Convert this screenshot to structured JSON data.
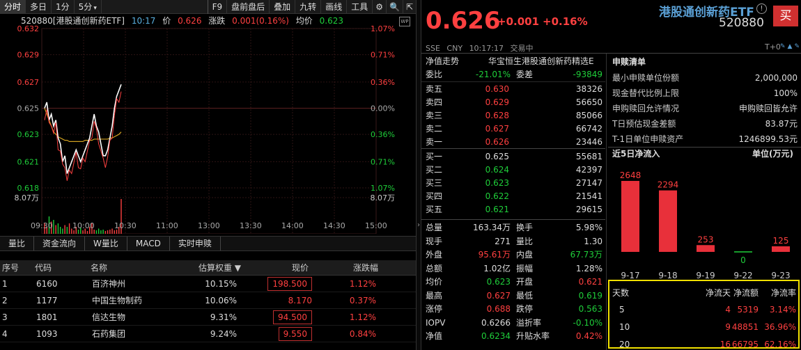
{
  "toolbar": {
    "tabs": [
      "分时",
      "多日",
      "1分",
      "5分"
    ],
    "tab5_arrow": "▾",
    "right_tabs": [
      "F9",
      "盘前盘后",
      "叠加",
      "九转",
      "画线",
      "工具"
    ]
  },
  "chart_header": {
    "code_name": "520880[港股通创新药ETF]",
    "time": "10:17",
    "price_label": "价",
    "price": "0.626",
    "change_label": "涨跌",
    "change": "0.001(0.16%)",
    "avg_label": "均价",
    "avg": "0.623"
  },
  "chart_data": {
    "type": "line",
    "y_left_ticks": [
      "0.632",
      "0.629",
      "0.627",
      "0.625",
      "0.623",
      "0.621",
      "0.618",
      "8.07万"
    ],
    "y_right_ticks": [
      "1.07%",
      "0.71%",
      "0.36%",
      "0.00%",
      "0.36%",
      "0.71%",
      "1.07%",
      "8.07万"
    ],
    "x_ticks": [
      "09:30",
      "10:00",
      "10:30",
      "11:00",
      "13:00",
      "13:30",
      "14:00",
      "14:30",
      "15:00"
    ],
    "ylim": [
      0.6183,
      0.6317
    ],
    "prev_close": 0.625,
    "price_series": [
      0.625,
      0.6255,
      0.624,
      0.6245,
      0.6235,
      0.624,
      0.6225,
      0.622,
      0.6205,
      0.621,
      0.6195,
      0.62,
      0.6205,
      0.621,
      0.6215,
      0.621,
      0.6205,
      0.621,
      0.6215,
      0.622,
      0.6225,
      0.6235,
      0.6245,
      0.6235,
      0.623,
      0.622,
      0.621,
      0.621,
      0.6215,
      0.6225,
      0.6235,
      0.625,
      0.626,
      0.6265,
      0.627
    ],
    "avg_series": [
      0.625,
      0.6245,
      0.624,
      0.6235,
      0.623,
      0.6228,
      0.6226,
      0.6225,
      0.6224,
      0.6223,
      0.6223,
      0.6222,
      0.6222,
      0.6222,
      0.6222,
      0.6222,
      0.6222,
      0.6222,
      0.6223,
      0.6223,
      0.6223,
      0.6223,
      0.6224,
      0.6224,
      0.6224,
      0.6224,
      0.6224,
      0.6224,
      0.6224,
      0.6225,
      0.6225,
      0.6226,
      0.6227,
      0.6228,
      0.623
    ],
    "volume_series": [
      0.3,
      0.2,
      0.5,
      0.35,
      0.4,
      0.25,
      0.3,
      0.2,
      0.15,
      0.25,
      0.2,
      0.3,
      0.15,
      0.1,
      0.2,
      0.12,
      0.18,
      0.1,
      0.15,
      0.08,
      0.2,
      0.3,
      0.12,
      0.1,
      0.15,
      0.1,
      0.12,
      0.08,
      0.1,
      0.12,
      0.15,
      0.1,
      0.12,
      0.2,
      1.0
    ]
  },
  "subtabs": [
    "量比",
    "资金流向",
    "W量比",
    "MACD",
    "实时申赎"
  ],
  "constituents": {
    "headers": [
      "序号",
      "代码",
      "名称",
      "估算权重 ▼",
      "现价",
      "涨跌幅"
    ],
    "rows": [
      {
        "idx": "1",
        "code": "6160",
        "name": "百济神州",
        "weight": "10.15%",
        "price": "198.500",
        "chg": "1.12%"
      },
      {
        "idx": "2",
        "code": "1177",
        "name": "中国生物制药",
        "weight": "10.06%",
        "price": "8.170",
        "chg": "0.37%"
      },
      {
        "idx": "3",
        "code": "1801",
        "name": "信达生物",
        "weight": "9.31%",
        "price": "94.500",
        "chg": "1.12%"
      },
      {
        "idx": "4",
        "code": "1093",
        "name": "石药集团",
        "weight": "9.24%",
        "price": "9.550",
        "chg": "0.84%"
      }
    ]
  },
  "quote": {
    "price": "0.626",
    "change": "+0.001",
    "pct": "+0.16%",
    "fund_name": "港股通创新药ETF",
    "fund_code": "520880",
    "buy_label": "买",
    "exchange": "SSE",
    "currency": "CNY",
    "time": "10:17:17",
    "status": "交易中",
    "t0": "T+0",
    "nav_trend": "净值走势",
    "fund_full": "华宝恒生港股通创新药精选E",
    "weibi_label": "委比",
    "weibi": "-21.01%",
    "weicha_label": "委差",
    "weicha": "-93849"
  },
  "order_book": {
    "asks": [
      {
        "label": "卖五",
        "price": "0.630",
        "vol": "38326"
      },
      {
        "label": "卖四",
        "price": "0.629",
        "vol": "56650"
      },
      {
        "label": "卖三",
        "price": "0.628",
        "vol": "85066"
      },
      {
        "label": "卖二",
        "price": "0.627",
        "vol": "66742"
      },
      {
        "label": "卖一",
        "price": "0.626",
        "vol": "23446"
      }
    ],
    "bids": [
      {
        "label": "买一",
        "price": "0.625",
        "vol": "55681"
      },
      {
        "label": "买二",
        "price": "0.624",
        "vol": "42397"
      },
      {
        "label": "买三",
        "price": "0.623",
        "vol": "27147"
      },
      {
        "label": "买四",
        "price": "0.622",
        "vol": "21541"
      },
      {
        "label": "买五",
        "price": "0.621",
        "vol": "29615"
      }
    ]
  },
  "stats": [
    {
      "k1": "总量",
      "v1": "163.34万",
      "k2": "换手",
      "v2": "5.98%"
    },
    {
      "k1": "现手",
      "v1": "271",
      "k2": "量比",
      "v2": "1.30"
    },
    {
      "k1": "外盘",
      "v1": "95.61万",
      "k2": "内盘",
      "v2": "67.73万"
    },
    {
      "k1": "总额",
      "v1": "1.02亿",
      "k2": "振幅",
      "v2": "1.28%"
    },
    {
      "k1": "均价",
      "v1": "0.623",
      "k2": "开盘",
      "v2": "0.621"
    },
    {
      "k1": "最高",
      "v1": "0.627",
      "k2": "最低",
      "v2": "0.619"
    },
    {
      "k1": "涨停",
      "v1": "0.688",
      "k2": "跌停",
      "v2": "0.563"
    },
    {
      "k1": "IOPV",
      "v1": "0.6266",
      "k2": "溢折率",
      "v2": "-0.10%"
    },
    {
      "k1": "净值",
      "v1": "0.6234",
      "k2": "升贴水率",
      "v2": "0.42%"
    }
  ],
  "redemption": {
    "title": "申赎清单",
    "rows": [
      {
        "k": "最小申赎单位份额",
        "v": "2,000,000"
      },
      {
        "k": "现金替代比例上限",
        "v": "100%"
      },
      {
        "k": "申购赎回允许情况",
        "v": "申购赎回皆允许"
      },
      {
        "k": "T日预估现金差额",
        "v": "83.87元"
      },
      {
        "k": "T-1日单位申赎资产",
        "v": "1246899.53元"
      }
    ]
  },
  "inflow": {
    "title": "近5日净流入",
    "unit": "单位(万元)",
    "chart_data": {
      "type": "bar",
      "categories": [
        "9-17",
        "9-18",
        "9-19",
        "9-22",
        "9-23"
      ],
      "values": [
        2648,
        2294,
        253,
        0,
        125
      ]
    },
    "table": {
      "headers": [
        "天数",
        "净流天",
        "净流额",
        "净流率"
      ],
      "rows": [
        {
          "days": "5",
          "flow_days": "4",
          "amount": "5319",
          "rate": "3.14%"
        },
        {
          "days": "10",
          "flow_days": "9",
          "amount": "48851",
          "rate": "36.96%"
        },
        {
          "days": "20",
          "flow_days": "16",
          "amount": "66795",
          "rate": "62.16%"
        }
      ]
    }
  },
  "colors": {
    "up": "#ff4040",
    "down": "#1fcf3a",
    "avg_line": "#d0a020",
    "highlight": "#f0e000"
  }
}
